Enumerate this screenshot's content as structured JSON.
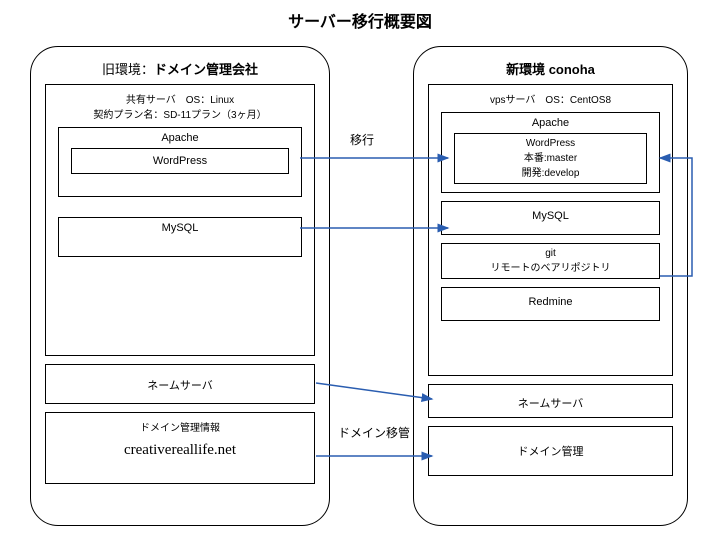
{
  "title": "サーバー移行概要図",
  "old_env": {
    "title_prefix": "旧環境：",
    "title_bold": "ドメイン管理会社",
    "server_line1": "共有サーバ　OS：Linux",
    "server_line2": "契約プラン名：SD-11プラン（3ヶ月）",
    "apache": "Apache",
    "wordpress": "WordPress",
    "mysql": "MySQL",
    "nameserver": "ネームサーバ",
    "domain_box_title": "ドメイン管理情報",
    "domain_name": "creativereallife.net"
  },
  "new_env": {
    "title": "新環境 conoha",
    "server_line1": "vpsサーバ　OS：CentOS8",
    "apache": "Apache",
    "wordpress_l1": "WordPress",
    "wordpress_l2": "本番:master",
    "wordpress_l3": "開発:develop",
    "mysql": "MySQL",
    "git_l1": "git",
    "git_l2": "リモートのベアリポジトリ",
    "redmine": "Redmine",
    "nameserver": "ネームサーバ",
    "domain_mgmt": "ドメイン管理"
  },
  "edges": {
    "migrate": "移行",
    "domain_transfer": "ドメイン移管"
  },
  "chart_data": {
    "type": "diagram",
    "title": "サーバー移行概要図",
    "nodes": [
      {
        "id": "old_env",
        "label": "旧環境：ドメイン管理会社",
        "children": [
          "old_server",
          "old_ns",
          "old_domain"
        ]
      },
      {
        "id": "old_server",
        "label": "共有サーバ OS:Linux / 契約プラン名:SD-11プラン(3ヶ月)",
        "children": [
          "old_apache",
          "old_mysql"
        ]
      },
      {
        "id": "old_apache",
        "label": "Apache",
        "children": [
          "old_wp"
        ]
      },
      {
        "id": "old_wp",
        "label": "WordPress"
      },
      {
        "id": "old_mysql",
        "label": "MySQL"
      },
      {
        "id": "old_ns",
        "label": "ネームサーバ"
      },
      {
        "id": "old_domain",
        "label": "ドメイン管理情報 / creativereallife.net"
      },
      {
        "id": "new_env",
        "label": "新環境 conoha",
        "children": [
          "new_server",
          "new_ns",
          "new_domain"
        ]
      },
      {
        "id": "new_server",
        "label": "vpsサーバ OS:CentOS8",
        "children": [
          "new_apache",
          "new_mysql",
          "new_git",
          "new_redmine"
        ]
      },
      {
        "id": "new_apache",
        "label": "Apache",
        "children": [
          "new_wp"
        ]
      },
      {
        "id": "new_wp",
        "label": "WordPress 本番:master 開発:develop"
      },
      {
        "id": "new_mysql",
        "label": "MySQL"
      },
      {
        "id": "new_git",
        "label": "git リモートのベアリポジトリ"
      },
      {
        "id": "new_redmine",
        "label": "Redmine"
      },
      {
        "id": "new_ns",
        "label": "ネームサーバ"
      },
      {
        "id": "new_domain",
        "label": "ドメイン管理"
      }
    ],
    "edges": [
      {
        "from": "old_wp",
        "to": "new_wp",
        "label": "移行"
      },
      {
        "from": "old_mysql",
        "to": "new_mysql",
        "label": ""
      },
      {
        "from": "old_ns",
        "to": "new_ns",
        "label": ""
      },
      {
        "from": "old_domain",
        "to": "new_domain",
        "label": "ドメイン移管"
      },
      {
        "from": "new_git",
        "to": "new_wp",
        "label": ""
      }
    ]
  }
}
